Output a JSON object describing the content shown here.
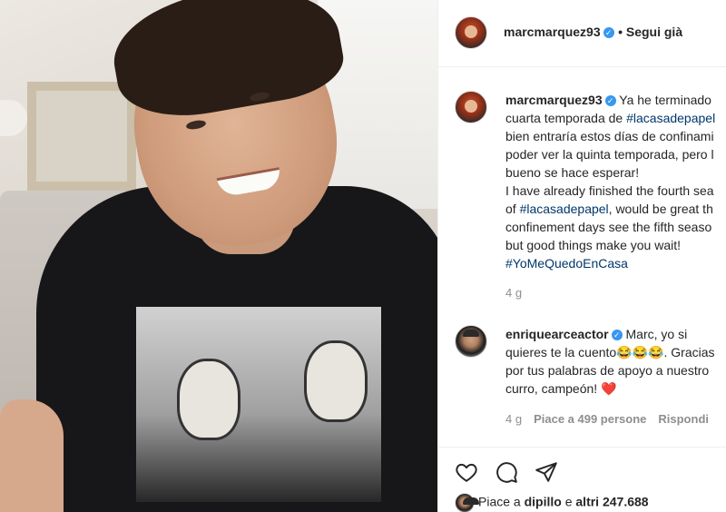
{
  "post": {
    "author": "marcmarquez93",
    "follow_status": "• Segui già",
    "caption_lines": [
      "Ya he terminado",
      "cuarta temporada de ",
      "bien entraría estos días de confinami",
      "poder ver la quinta temporada, pero l",
      "bueno se hace esperar!",
      "I have already finished the fourth sea",
      "of ",
      ", would be great th",
      "confinement days see the fifth seaso",
      "but good things make you wait!"
    ],
    "hashtag_1": "#lacasadepapel",
    "hashtag_2": "#lacasadepapel",
    "hashtag_3": "#YoMeQuedoEnCasa",
    "time": "4 g"
  },
  "comment": {
    "author": "enriquearceactor",
    "lines": [
      "Marc, yo si",
      "quieres te la cuento😂😂😂. Gracias",
      "por tus palabras de apoyo a nuestro",
      "curro, campeón! ❤️"
    ],
    "time": "4 g",
    "likes_label": "Piace a 499 persone",
    "reply_label": "Rispondi"
  },
  "likes": {
    "prefix": "Piace a ",
    "user": "dipillo",
    "middle": " e ",
    "others": "altri 247.688"
  },
  "icons": {
    "like": "heart-icon",
    "comment": "comment-icon",
    "share": "share-icon",
    "verified": "verified-badge-icon"
  },
  "colors": {
    "hashtag": "#00376b",
    "verified": "#3897f0",
    "meta": "#8e8e8e"
  }
}
